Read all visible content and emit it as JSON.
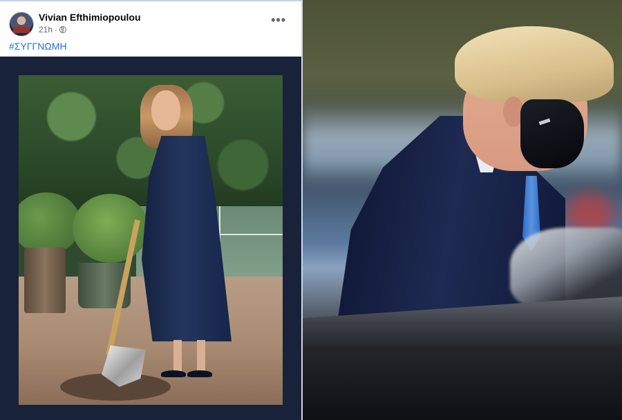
{
  "post": {
    "author": "Vivian Efthimiopoulou",
    "time": "21h",
    "separator": "·",
    "privacy_icon": "globe-icon",
    "more_icon": "more-options-icon",
    "more_label": "•••",
    "hashtag": "#ΣΥΓΓΝΩΜΗ"
  },
  "colors": {
    "link": "#216fdb",
    "post_background": "#18233a",
    "header_background": "#ffffff"
  }
}
